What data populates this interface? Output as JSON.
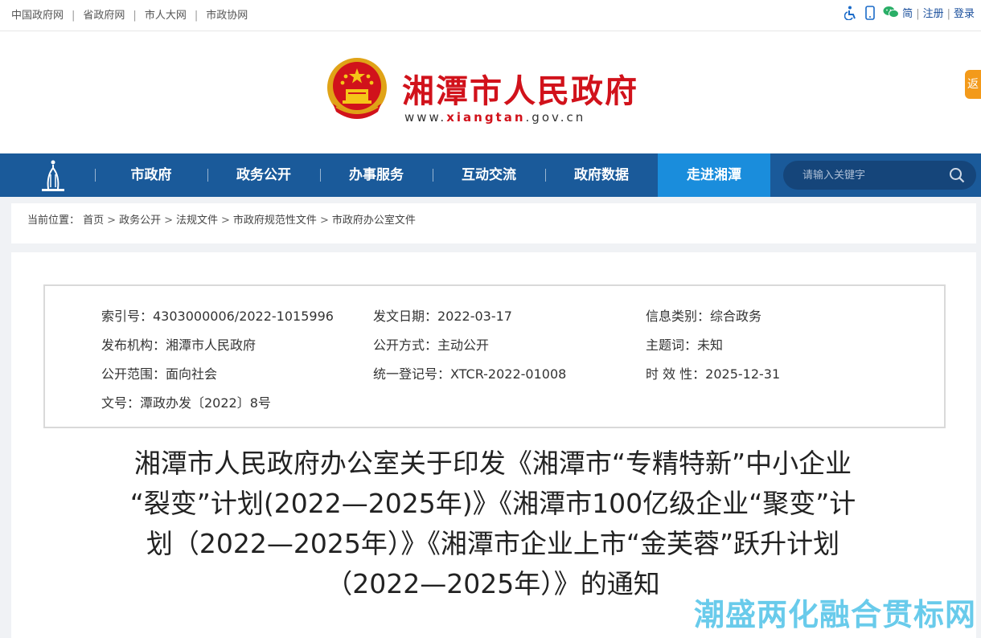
{
  "topbar": {
    "links": [
      "中国政府网",
      "省政府网",
      "市人大网",
      "市政协网"
    ],
    "separator": "|",
    "accessibility_icon": "wheelchair-icon",
    "mobile_icon": "mobile-phone-icon",
    "wechat_icon": "wechat-icon",
    "right_links": [
      "简",
      "注册",
      "登录"
    ]
  },
  "header": {
    "site_title": "湘潭市人民政府",
    "url_prefix": "www.",
    "url_highlight": "xiangtan",
    "url_suffix": ".gov.cn",
    "side_tab": "返"
  },
  "nav": {
    "items": [
      "市政府",
      "政务公开",
      "办事服务",
      "互动交流",
      "政府数据",
      "走进湘潭"
    ],
    "active_index": 5,
    "search_placeholder": "请输入关键字"
  },
  "breadcrumb": {
    "label": "当前位置：",
    "items": [
      "首页",
      "政务公开",
      "法规文件",
      "市政府规范性文件",
      "市政府办公室文件"
    ],
    "separator": ">"
  },
  "meta": {
    "index_no": "索引号：4303000006/2022-1015996",
    "issue_date": "发文日期：2022-03-17",
    "info_category": "信息类别：综合政务",
    "publisher": "发布机构：湘潭市人民政府",
    "disclosure_mode": "公开方式：主动公开",
    "keywords": "主题词：未知",
    "disclosure_scope": "公开范围：面向社会",
    "registration_no": "统一登记号：XTCR-2022-01008",
    "validity": "时 效 性：2025-12-31",
    "doc_no": "文号：潭政办发〔2022〕8号"
  },
  "document": {
    "title_lines": [
      "湘潭市人民政府办公室关于印发《湘潭市“专精特新”中小企业",
      "“裂变”计划(2022—2025年)》《湘潭市100亿级企业“聚变”计",
      "划（2022—2025年）》《湘潭市企业上市“金芙蓉”跃升计划",
      "（2022—2025年）》的通知"
    ]
  },
  "watermark": "潮盛两化融合贯标网",
  "colors": {
    "brand_red": "#d1121b",
    "nav_blue": "#1a5a9a",
    "nav_active": "#1a8ddc",
    "watermark": "#4fc3e8"
  }
}
